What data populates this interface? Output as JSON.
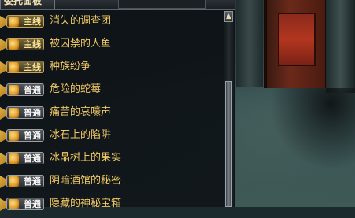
{
  "panel": {
    "title": "委托面板",
    "scroll_up_glyph": "▲"
  },
  "quests": [
    {
      "type": "主线",
      "kind": "main",
      "name": "消失的调查团"
    },
    {
      "type": "主线",
      "kind": "main",
      "name": "被囚禁的人鱼"
    },
    {
      "type": "主线",
      "kind": "main",
      "name": "种族纷争"
    },
    {
      "type": "普通",
      "kind": "normal",
      "name": "危险的蛇莓"
    },
    {
      "type": "普通",
      "kind": "normal",
      "name": "痛苦的哀嚎声"
    },
    {
      "type": "普通",
      "kind": "normal",
      "name": "冰石上的陷阱"
    },
    {
      "type": "普通",
      "kind": "normal",
      "name": "冰晶树上的果实"
    },
    {
      "type": "普通",
      "kind": "normal",
      "name": "阴暗酒馆的秘密"
    },
    {
      "type": "普通",
      "kind": "normal",
      "name": "隐藏的神秘宝箱"
    }
  ],
  "colors": {
    "quest_text": "#f1c863",
    "main_badge_text": "#ffe89a",
    "normal_badge_text": "#f3f3f3"
  }
}
